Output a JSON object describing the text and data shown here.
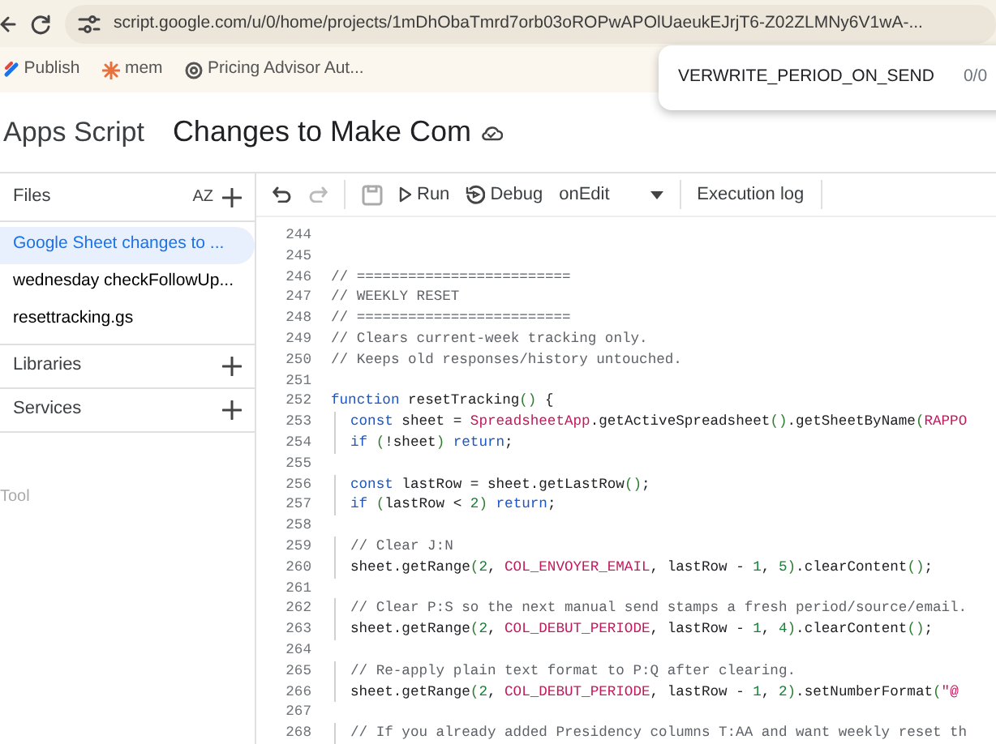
{
  "browser": {
    "url": "script.google.com/u/0/home/projects/1mDhObaTmrd7orb03oROPwAPOlUaeukEJrjT6-Z02ZLMNy6V1wA-...",
    "bookmarks": [
      {
        "label": "Publish",
        "kind": "publish"
      },
      {
        "label": "mem",
        "kind": "burst"
      },
      {
        "label": "Pricing Advisor Aut...",
        "kind": "knot"
      }
    ],
    "find_bar": {
      "query": "VERWRITE_PERIOD_ON_SEND",
      "count": "0/0"
    }
  },
  "app": {
    "product": "Apps Script",
    "project_title": "Changes to Make Com"
  },
  "sidebar": {
    "files_heading": "Files",
    "sort_label": "AZ",
    "files": [
      {
        "name": "Google Sheet changes to ...",
        "selected": true
      },
      {
        "name": "wednesday checkFollowUp...",
        "selected": false
      },
      {
        "name": "resettracking.gs",
        "selected": false
      }
    ],
    "sections": [
      {
        "label": "Libraries"
      },
      {
        "label": "Services"
      }
    ],
    "footer_text": "Tool"
  },
  "toolbar": {
    "run": "Run",
    "debug": "Debug",
    "function": "onEdit",
    "execution_log": "Execution log"
  },
  "editor": {
    "lines": [
      {
        "number": "244"
      },
      {
        "number": "245"
      },
      {
        "number": "246",
        "tokens": [
          {
            "kind": "comment",
            "text": "// ========================="
          }
        ]
      },
      {
        "number": "247",
        "tokens": [
          {
            "kind": "comment",
            "text": "// WEEKLY RESET"
          }
        ]
      },
      {
        "number": "248",
        "tokens": [
          {
            "kind": "comment",
            "text": "// ========================="
          }
        ]
      },
      {
        "number": "249",
        "tokens": [
          {
            "kind": "comment",
            "text": "// Clears current-week tracking only."
          }
        ]
      },
      {
        "number": "250",
        "tokens": [
          {
            "kind": "comment",
            "text": "// Keeps old responses/history untouched."
          }
        ]
      },
      {
        "number": "251"
      },
      {
        "number": "252",
        "tokens": [
          {
            "kind": "keyword",
            "text": "function"
          },
          {
            "kind": "plain",
            "text": " resetTracking"
          },
          {
            "kind": "paren",
            "text": "()"
          },
          {
            "kind": "plain",
            "text": " {"
          }
        ]
      },
      {
        "number": "253",
        "indented": true,
        "tokens": [
          {
            "kind": "keyword",
            "text": "const"
          },
          {
            "kind": "plain",
            "text": " sheet = "
          },
          {
            "kind": "ident",
            "text": "SpreadsheetApp"
          },
          {
            "kind": "plain",
            "text": ".getActiveSpreadsheet"
          },
          {
            "kind": "paren",
            "text": "()"
          },
          {
            "kind": "plain",
            "text": ".getSheetByName"
          },
          {
            "kind": "paren",
            "text": "("
          },
          {
            "kind": "ident",
            "text": "RAPPO"
          }
        ]
      },
      {
        "number": "254",
        "indented": true,
        "tokens": [
          {
            "kind": "keyword",
            "text": "if"
          },
          {
            "kind": "paren",
            "text": " ("
          },
          {
            "kind": "plain",
            "text": "!sheet"
          },
          {
            "kind": "paren",
            "text": ")"
          },
          {
            "kind": "keyword",
            "text": " return"
          },
          {
            "kind": "plain",
            "text": ";"
          }
        ]
      },
      {
        "number": "255"
      },
      {
        "number": "256",
        "indented": true,
        "tokens": [
          {
            "kind": "keyword",
            "text": "const"
          },
          {
            "kind": "plain",
            "text": " lastRow = sheet.getLastRow"
          },
          {
            "kind": "paren",
            "text": "()"
          },
          {
            "kind": "plain",
            "text": ";"
          }
        ]
      },
      {
        "number": "257",
        "indented": true,
        "tokens": [
          {
            "kind": "keyword",
            "text": "if"
          },
          {
            "kind": "paren",
            "text": " ("
          },
          {
            "kind": "plain",
            "text": "lastRow < "
          },
          {
            "kind": "number",
            "text": "2"
          },
          {
            "kind": "paren",
            "text": ")"
          },
          {
            "kind": "keyword",
            "text": " return"
          },
          {
            "kind": "plain",
            "text": ";"
          }
        ]
      },
      {
        "number": "258"
      },
      {
        "number": "259",
        "indented": true,
        "tokens": [
          {
            "kind": "comment",
            "text": "// Clear J:N"
          }
        ]
      },
      {
        "number": "260",
        "indented": true,
        "tokens": [
          {
            "kind": "plain",
            "text": "sheet.getRange"
          },
          {
            "kind": "paren",
            "text": "("
          },
          {
            "kind": "number",
            "text": "2"
          },
          {
            "kind": "plain",
            "text": ", "
          },
          {
            "kind": "ident",
            "text": "COL_ENVOYER_EMAIL"
          },
          {
            "kind": "plain",
            "text": ", lastRow - "
          },
          {
            "kind": "number",
            "text": "1"
          },
          {
            "kind": "plain",
            "text": ", "
          },
          {
            "kind": "number",
            "text": "5"
          },
          {
            "kind": "paren",
            "text": ")"
          },
          {
            "kind": "plain",
            "text": ".clearContent"
          },
          {
            "kind": "paren",
            "text": "()"
          },
          {
            "kind": "plain",
            "text": ";"
          }
        ]
      },
      {
        "number": "261"
      },
      {
        "number": "262",
        "indented": true,
        "tokens": [
          {
            "kind": "comment",
            "text": "// Clear P:S so the next manual send stamps a fresh period/source/email."
          }
        ]
      },
      {
        "number": "263",
        "indented": true,
        "tokens": [
          {
            "kind": "plain",
            "text": "sheet.getRange"
          },
          {
            "kind": "paren",
            "text": "("
          },
          {
            "kind": "number",
            "text": "2"
          },
          {
            "kind": "plain",
            "text": ", "
          },
          {
            "kind": "ident",
            "text": "COL_DEBUT_PERIODE"
          },
          {
            "kind": "plain",
            "text": ", lastRow - "
          },
          {
            "kind": "number",
            "text": "1"
          },
          {
            "kind": "plain",
            "text": ", "
          },
          {
            "kind": "number",
            "text": "4"
          },
          {
            "kind": "paren",
            "text": ")"
          },
          {
            "kind": "plain",
            "text": ".clearContent"
          },
          {
            "kind": "paren",
            "text": "()"
          },
          {
            "kind": "plain",
            "text": ";"
          }
        ]
      },
      {
        "number": "264"
      },
      {
        "number": "265",
        "indented": true,
        "tokens": [
          {
            "kind": "comment",
            "text": "// Re-apply plain text format to P:Q after clearing."
          }
        ]
      },
      {
        "number": "266",
        "indented": true,
        "tokens": [
          {
            "kind": "plain",
            "text": "sheet.getRange"
          },
          {
            "kind": "paren",
            "text": "("
          },
          {
            "kind": "number",
            "text": "2"
          },
          {
            "kind": "plain",
            "text": ", "
          },
          {
            "kind": "ident",
            "text": "COL_DEBUT_PERIODE"
          },
          {
            "kind": "plain",
            "text": ", lastRow - "
          },
          {
            "kind": "number",
            "text": "1"
          },
          {
            "kind": "plain",
            "text": ", "
          },
          {
            "kind": "number",
            "text": "2"
          },
          {
            "kind": "paren",
            "text": ")"
          },
          {
            "kind": "plain",
            "text": ".setNumberFormat"
          },
          {
            "kind": "paren",
            "text": "("
          },
          {
            "kind": "string",
            "text": "\"@"
          }
        ]
      },
      {
        "number": "267"
      },
      {
        "number": "268",
        "indented": true,
        "tokens": [
          {
            "kind": "comment",
            "text": "// If you already added Presidency columns T:AA and want weekly reset th"
          }
        ]
      }
    ]
  }
}
